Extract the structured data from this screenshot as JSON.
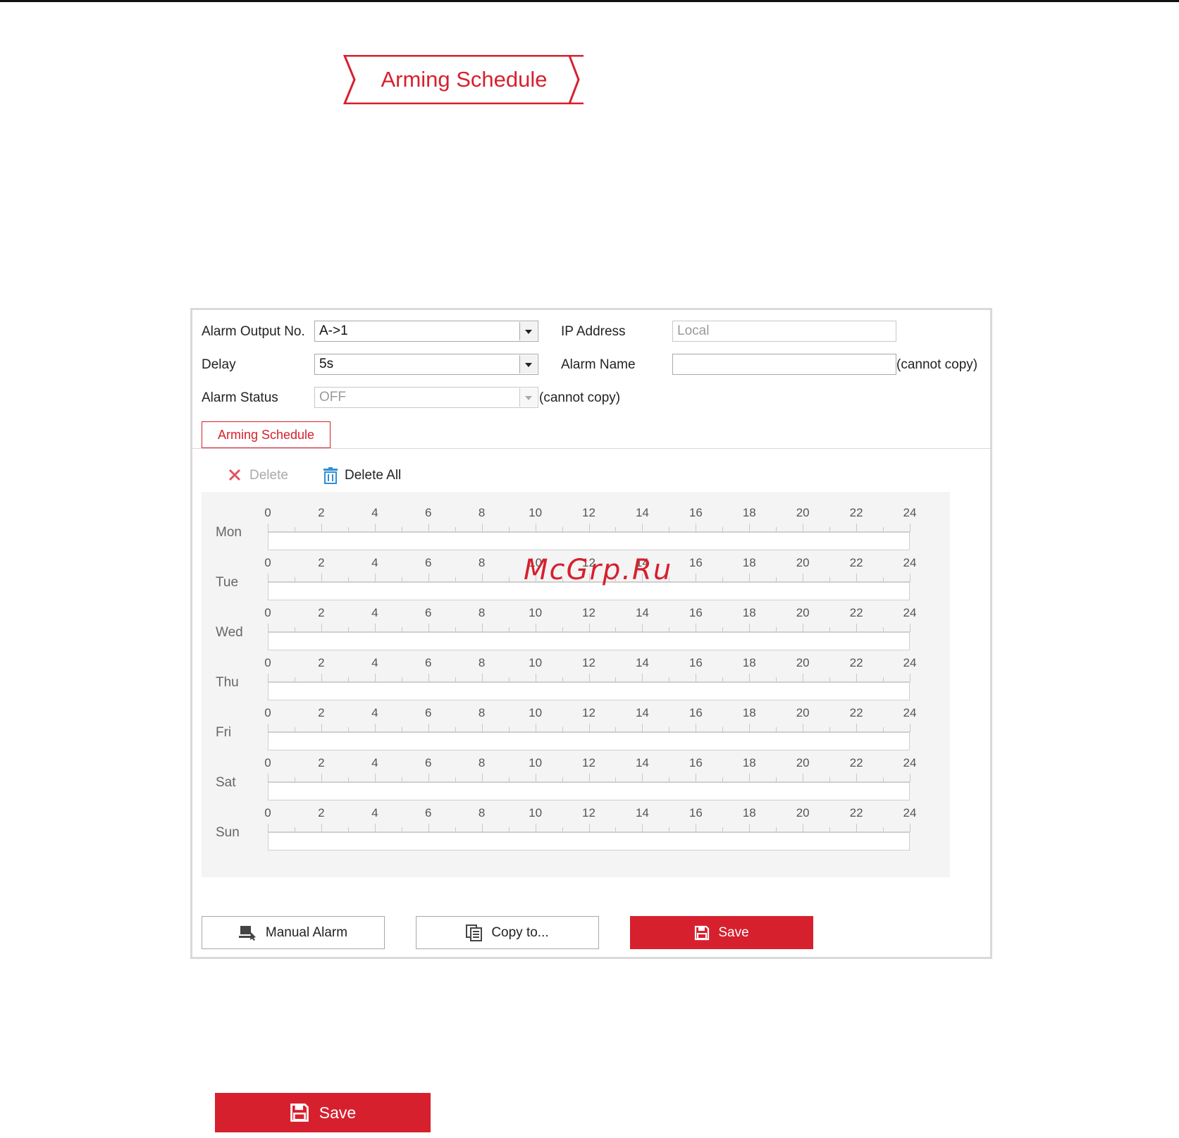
{
  "header": {
    "banner_title": "Arming Schedule"
  },
  "form": {
    "alarm_output_no": {
      "label": "Alarm Output No.",
      "value": "A->1"
    },
    "delay": {
      "label": "Delay",
      "value": "5s"
    },
    "alarm_status": {
      "label": "Alarm Status",
      "value": "OFF",
      "note": "(cannot copy)"
    },
    "ip_address": {
      "label": "IP Address",
      "placeholder": "Local"
    },
    "alarm_name": {
      "label": "Alarm Name",
      "value": "",
      "note": "(cannot copy)"
    }
  },
  "tabs": [
    {
      "label": "Arming Schedule",
      "active": true
    }
  ],
  "toolbar": {
    "delete_label": "Delete",
    "delete_all_label": "Delete All"
  },
  "schedule": {
    "days": [
      "Mon",
      "Tue",
      "Wed",
      "Thu",
      "Fri",
      "Sat",
      "Sun"
    ],
    "hour_labels": [
      "0",
      "2",
      "4",
      "6",
      "8",
      "10",
      "12",
      "14",
      "16",
      "18",
      "20",
      "22",
      "24"
    ]
  },
  "buttons": {
    "manual_alarm": "Manual Alarm",
    "copy_to": "Copy to...",
    "save": "Save",
    "bottom_save": "Save"
  },
  "watermark": "McGrp.Ru",
  "colors": {
    "accent": "#d7202e",
    "panel_border": "#d9d9d9",
    "schedule_bg": "#f4f4f4"
  }
}
